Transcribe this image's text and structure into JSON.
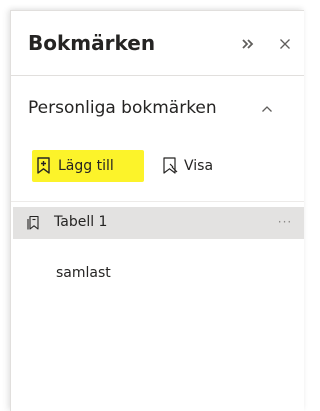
{
  "pane": {
    "title": "Bokmärken",
    "expand_icon": "double-chevron-right-icon",
    "close_icon": "close-icon"
  },
  "section": {
    "label": "Personliga bokmärken",
    "collapse_icon": "chevron-up-icon"
  },
  "toolbar": {
    "add_label": "Lägg till",
    "add_icon": "bookmark-add-icon",
    "add_highlight_color": "#fcf32a",
    "view_label": "Visa",
    "view_icon": "bookmark-view-icon"
  },
  "bookmarks": [
    {
      "label": "Tabell 1",
      "icon": "bookmark-group-icon",
      "selected": true,
      "more": "···"
    },
    {
      "label": "samlast",
      "selected": false
    }
  ]
}
